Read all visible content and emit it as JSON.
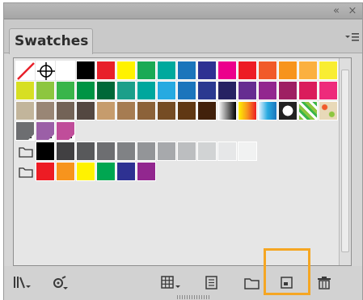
{
  "panel": {
    "tab_label": "Swatches",
    "collapse_icon": "double-chevron-left-icon",
    "close_icon": "close-icon",
    "menu_icon": "panel-menu-icon"
  },
  "swatch_rows": [
    [
      "none",
      "registration",
      "#ffffff",
      "#000000",
      "#e8202a",
      "#fff200",
      "#1aaa55",
      "#00a99d",
      "#1b75bb",
      "#2e3192",
      "#ec008c",
      "#ed1c24",
      "#f15a29",
      "#f7941d",
      "#fbb040",
      "#f9ed32"
    ],
    [
      "#d7df23",
      "#8dc63f",
      "#39b54a",
      "#009444",
      "#006838",
      "#1c9f8a",
      "#00a79d",
      "#27aae1",
      "#1c75bc",
      "#2b3990",
      "#262262",
      "#662d91",
      "#92278f",
      "#9e1f63",
      "#da1c5c",
      "#ee2a7b"
    ],
    [
      "#c2b59b",
      "#998675",
      "#736357",
      "#534741",
      "#c69c6d",
      "#a67c52",
      "#8c6239",
      "#754c24",
      "#603813",
      "#42210b",
      "gradient-bw",
      "gradient-orange",
      "gradient-blue",
      "radial",
      "pattern-leaves",
      "pattern-flowers"
    ],
    [
      "global-dark",
      "global-purple",
      "global-magenta"
    ],
    [
      "folder",
      "#000000",
      "#414042",
      "#58595b",
      "#6d6e71",
      "#808285",
      "#939598",
      "#a7a9ac",
      "#bcbec0",
      "#d1d3d4",
      "#e6e7e8",
      "#f1f2f2"
    ],
    [
      "folder",
      "#ed1c24",
      "#f7941d",
      "#fff200",
      "#00a651",
      "#2e3192",
      "#92278f"
    ]
  ],
  "toolbar": {
    "libraries_icon": "swatch-libraries-menu-icon",
    "show_kinds_icon": "show-swatch-kinds-icon",
    "options_icon": "swatch-options-icon",
    "new_group_icon": "new-color-group-icon",
    "folder_icon": "folder-icon",
    "new_swatch_icon": "new-swatch-icon",
    "delete_icon": "trash-icon"
  },
  "highlight_color": "#f5a623"
}
